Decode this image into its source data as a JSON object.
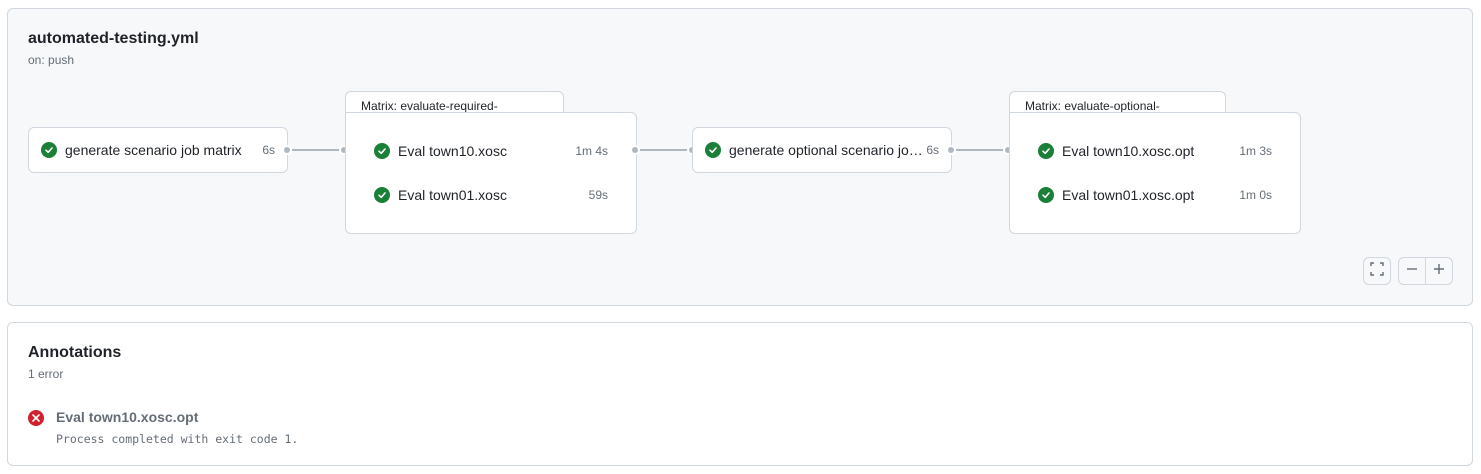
{
  "workflow": {
    "title": "automated-testing.yml",
    "trigger": "on: push",
    "jobs": [
      {
        "name": "generate scenario job matrix",
        "duration": "6s",
        "status": "success"
      }
    ],
    "matrix_required": {
      "label": "Matrix: evaluate-required-scenarios",
      "jobs": [
        {
          "name": "Eval town10.xosc",
          "duration": "1m 4s",
          "status": "success"
        },
        {
          "name": "Eval town01.xosc",
          "duration": "59s",
          "status": "success"
        }
      ]
    },
    "optional_job": {
      "name": "generate optional scenario jo…",
      "duration": "6s",
      "status": "success"
    },
    "matrix_optional": {
      "label": "Matrix: evaluate-optional-scenarios",
      "jobs": [
        {
          "name": "Eval town10.xosc.opt",
          "duration": "1m 3s",
          "status": "success"
        },
        {
          "name": "Eval town01.xosc.opt",
          "duration": "1m 0s",
          "status": "success"
        }
      ]
    },
    "controls": [
      "fullscreen-icon",
      "zoom-out-icon",
      "zoom-in-icon"
    ]
  },
  "annotations": {
    "title": "Annotations",
    "count": "1 error",
    "items": [
      {
        "title": "Eval town10.xosc.opt",
        "message": "Process completed with exit code 1.",
        "level": "error"
      }
    ]
  },
  "colors": {
    "success": "#1a7f37",
    "error": "#cf222e",
    "border": "#d0d7de",
    "panel_bg": "#f6f8fa"
  }
}
